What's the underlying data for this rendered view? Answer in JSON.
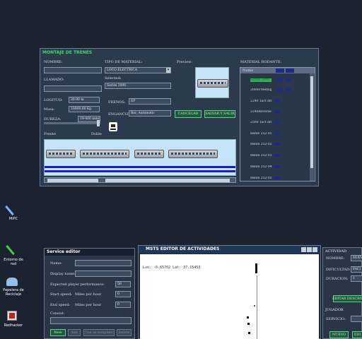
{
  "montaje": {
    "title": "MONTAJE DE TRENES",
    "nombre_label": "NOMBRE:",
    "llamado_label": "LLAMADO:",
    "tipo_label": "TIPO DE MATERIAL:",
    "tipo_value": "LOCO ELECTRICA",
    "selected_label": "Selected:",
    "selected_value": "Series 2000",
    "preview_label": "Preview:",
    "material_label": "MATERIAL RODANTE:",
    "longitud_label": "LOGITUD:",
    "longitud_value": "20.00 m",
    "masa_label": "Masa:",
    "masa_value": "10000.00 Kg",
    "dureza_label": "DUREZA:",
    "dureza_value": "19-400 mm/s",
    "frenos_label": "FRENOS:",
    "frenos_value": "EP",
    "enganches_label": "ENGANCHES:",
    "enganches_value": "Bar, Automatic",
    "cancelar": "CANCELAR",
    "salvar": "SALVAR Y SALIR",
    "frente_label": "Frente",
    "doble_label": "Doble",
    "list_header": "Name",
    "list_items": [
      "Series 2000",
      "2000Freeflag",
      "2240 Tact dri..",
      "2240Reversed",
      "2500 Tact dri..",
      "Renfe 252-01..",
      "Renfe 252-02..",
      "Renfe 252-03..",
      "Renfe 252-04..",
      "Renfe 252-05.."
    ]
  },
  "desktop": {
    "icons": [
      "MiPC",
      "Entorno de red",
      "Papelera de Reciclaje",
      "Redhacker"
    ]
  },
  "service": {
    "title": "Service editor",
    "name_label": "Name:",
    "display_label": "Display name:",
    "expected_label": "Expected player performance:",
    "expected_value": "50",
    "start_label": "Start speed:",
    "end_label": "End speed:",
    "mph": "Miles per hour",
    "start_value": "0",
    "end_value": "0",
    "consist_label": "Consist:",
    "new": "New",
    "add": "Add",
    "template": "Use as template",
    "delete": "Delete"
  },
  "msts": {
    "title": "MSTS EDITOR DE ACTIVIDADES",
    "coords": "Lon: -6.65702 Lat: 37.15453"
  },
  "actividad": {
    "section": "ACTIVIDAD",
    "nombre_label": "NOMBRE:",
    "nombre_value": "NUEV",
    "dificultad_label": "DIFICULTAD:",
    "dificultad_value": "FACI",
    "duracion_label": "DURACION:",
    "duracion_value": "1",
    "editar": "EDITAR DESCRIP",
    "jugador": "JUGADOR",
    "servicio_label": "SERVICIO:",
    "nuevo": "NUEVO",
    "edit": "EDI"
  }
}
